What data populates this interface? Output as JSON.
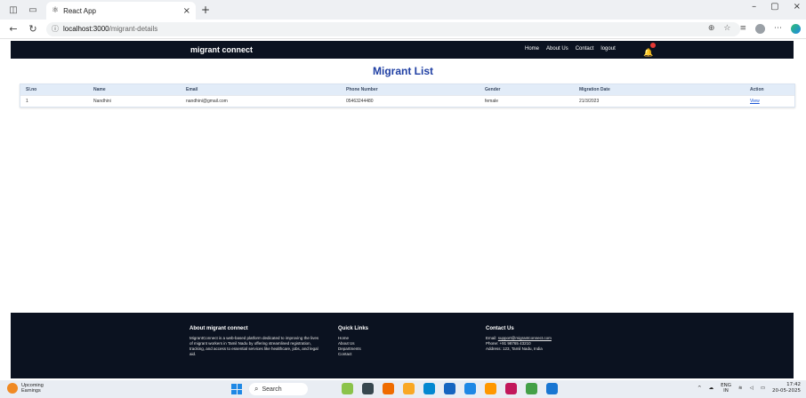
{
  "browser": {
    "tab_title": "React App",
    "close_glyph": "×",
    "new_tab_glyph": "+",
    "url_host": "localhost:3000",
    "url_path": "/migrant-details",
    "window_controls": [
      "–",
      "▢",
      "×"
    ]
  },
  "navbar": {
    "brand": "migrant connect",
    "links": [
      "Home",
      "About Us",
      "Contact",
      "logout"
    ],
    "bell_icon": "bell-icon"
  },
  "page": {
    "title": "Migrant List"
  },
  "table": {
    "headers": [
      "Sl.no",
      "Name",
      "Email",
      "Phone Number",
      "Gender",
      "Migration Date",
      "Action"
    ],
    "rows": [
      {
        "slno": "1",
        "name": "Nandhini",
        "email": "nandhini@gmail.com",
        "phone": "05463244480",
        "gender": "female",
        "migration_date": "21/3/2023",
        "action": "View"
      }
    ]
  },
  "footer": {
    "about": {
      "heading": "About migrant connect",
      "text": "MigrantConnect is a web-based platform dedicated to improving the lives of migrant workers in Tamil Nadu by offering streamlined registration, tracking, and access to essential services like healthcare, jobs, and legal aid."
    },
    "quick_links": {
      "heading": "Quick Links",
      "items": [
        "Home",
        "About Us",
        "Departments",
        "Contact"
      ]
    },
    "contact": {
      "heading": "Contact Us",
      "email_label": "Email:",
      "email": "support@migrantconnect.com",
      "phone": "Phone: +91 98765 43210",
      "address": "Address: 123, Tamil Nadu, India"
    }
  },
  "taskbar": {
    "weather_title": "Upcoming",
    "weather_sub": "Earnings",
    "search_label": "Search",
    "lang": "ENG",
    "region": "IN",
    "time": "17:42",
    "date": "20-05-2025"
  }
}
